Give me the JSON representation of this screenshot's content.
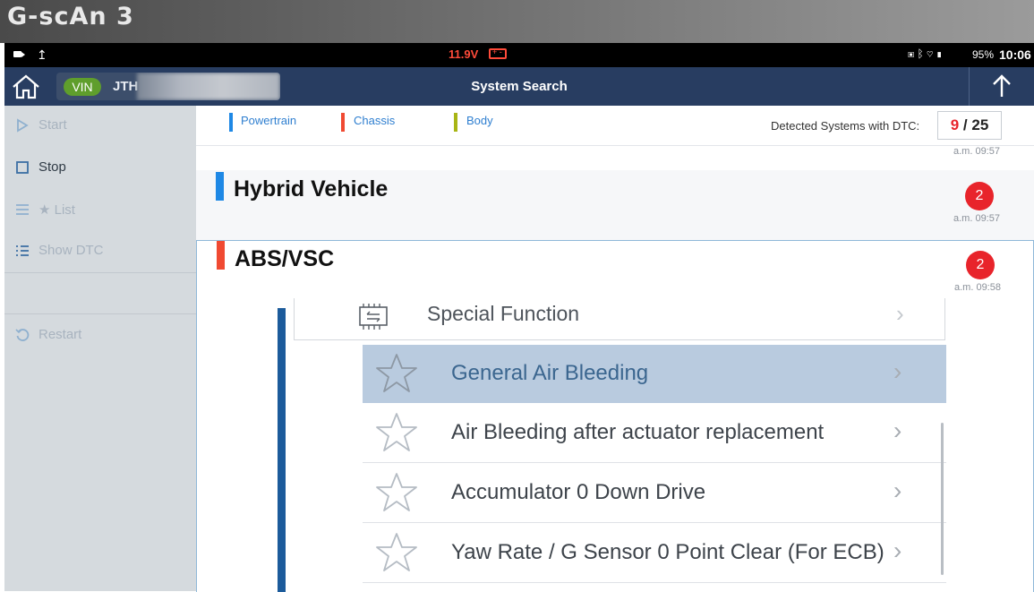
{
  "brand": {
    "logo": "G-scAn 3"
  },
  "status_bar": {
    "voltage": "11.9V",
    "battery_percent": "95%",
    "clock": "10:06",
    "alert_color": "#ff4b3a"
  },
  "header": {
    "vin_badge": "VIN",
    "vin_value": "JTH",
    "title": "System Search",
    "bg_color": "#283d61"
  },
  "sidebar": {
    "items": [
      {
        "label": "Start",
        "icon": "play-icon",
        "enabled": false
      },
      {
        "label": "Stop",
        "icon": "stop-square-icon",
        "enabled": true
      },
      {
        "label": "★ List",
        "icon": "menu-lines-icon",
        "enabled": false
      },
      {
        "label": "Show DTC",
        "icon": "list-bullets-icon",
        "enabled": false
      },
      {
        "label": "Restart",
        "icon": "restart-icon",
        "enabled": false
      }
    ]
  },
  "legend": {
    "items": [
      {
        "label": "Powertrain",
        "color": "#1e88e5"
      },
      {
        "label": "Chassis",
        "color": "#f04a32"
      },
      {
        "label": "Body",
        "color": "#a8b515"
      }
    ],
    "dtc_label": "Detected Systems with DTC:",
    "dtc_detected": "9",
    "dtc_separator": "/",
    "dtc_total": "25"
  },
  "systems": [
    {
      "timestamp": "a.m. 09:57"
    },
    {
      "name": "Hybrid Vehicle",
      "category_color": "#1e88e5",
      "dtc_count": "2",
      "timestamp": "a.m. 09:57"
    },
    {
      "name": "ABS/VSC",
      "category_color": "#f04a32",
      "dtc_count": "2",
      "timestamp": "a.m. 09:58"
    }
  ],
  "submenu": {
    "header": "Special Function",
    "items": [
      {
        "label": "General Air Bleeding",
        "selected": true
      },
      {
        "label": "Air Bleeding after actuator replacement",
        "selected": false
      },
      {
        "label": "Accumulator 0 Down Drive",
        "selected": false
      },
      {
        "label": "Yaw Rate / G Sensor 0 Point Clear (For ECB)",
        "selected": false
      }
    ]
  }
}
